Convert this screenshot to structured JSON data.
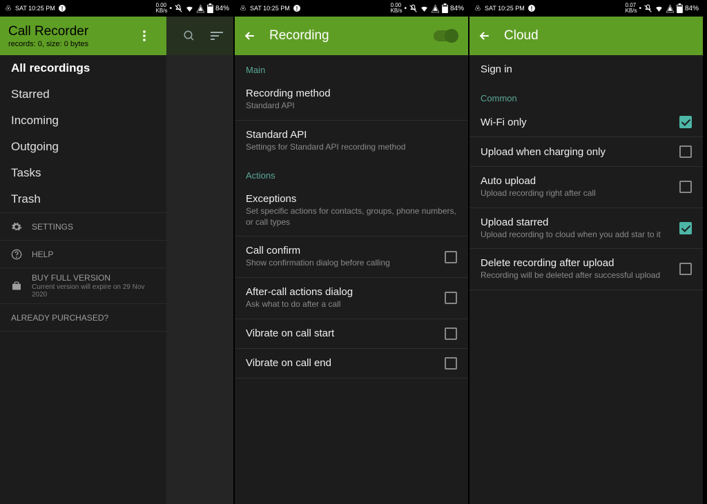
{
  "status": {
    "time": "SAT 10:25 PM",
    "net1": "0.00",
    "net1unit": "KB/s",
    "net2": "0.07",
    "net2unit": "KB/s",
    "battery": "84%"
  },
  "screen1": {
    "title": "Call Recorder",
    "subtitle": "records: 0, size: 0 bytes",
    "nav": {
      "all": "All recordings",
      "starred": "Starred",
      "incoming": "Incoming",
      "outgoing": "Outgoing",
      "tasks": "Tasks",
      "trash": "Trash"
    },
    "settings": "SETTINGS",
    "help": "HELP",
    "buy": "BUY FULL VERSION",
    "buy_sub": "Current version will expire on 29 Nov 2020",
    "purchased": "ALREADY PURCHASED?"
  },
  "screen2": {
    "title": "Recording",
    "sections": {
      "main": "Main",
      "actions": "Actions"
    },
    "items": {
      "method_t": "Recording method",
      "method_s": "Standard API",
      "api_t": "Standard API",
      "api_s": "Settings for Standard API recording method",
      "exc_t": "Exceptions",
      "exc_s": "Set specific actions for contacts, groups, phone numbers, or call types",
      "confirm_t": "Call confirm",
      "confirm_s": "Show confirmation dialog before calling",
      "after_t": "After-call actions dialog",
      "after_s": "Ask what to do after a call",
      "vib_start": "Vibrate on call start",
      "vib_end": "Vibrate on call end"
    }
  },
  "screen3": {
    "title": "Cloud",
    "signin": "Sign in",
    "section": "Common",
    "items": {
      "wifi": "Wi-Fi only",
      "charging": "Upload when charging only",
      "auto_t": "Auto upload",
      "auto_s": "Upload recording right after call",
      "starred_t": "Upload starred",
      "starred_s": "Upload recording to cloud when you add star to it",
      "delete_t": "Delete recording after upload",
      "delete_s": "Recording will be deleted after successful upload"
    }
  }
}
